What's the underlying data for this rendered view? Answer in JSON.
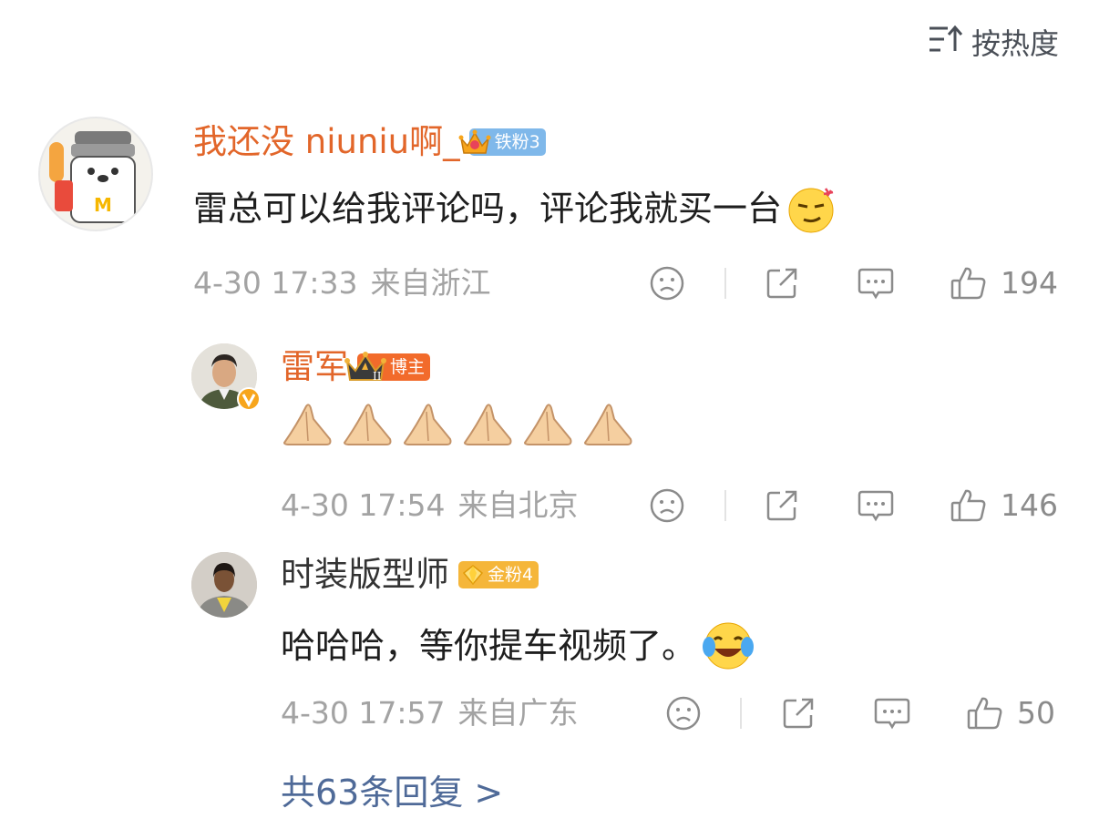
{
  "sort": {
    "label": "按热度",
    "icon": "sort-icon"
  },
  "comments": [
    {
      "username": "我还没 niuniu啊_",
      "badge": {
        "label": "铁粉3",
        "icon": "crown-icon",
        "color": "#7fb8ea"
      },
      "text": "雷总可以给我评论吗，评论我就买一台",
      "emoji": "smirk-emoji",
      "date": "4-30 17:33",
      "location": "来自浙江",
      "likes": "194"
    },
    {
      "username": "雷军",
      "badge": {
        "label": "博主",
        "icon": "crown-icon",
        "color": "#f26b2b"
      },
      "text": "",
      "emoji": "pray-hands-emoji",
      "verified_icon": "verified-v-icon",
      "date": "4-30 17:54",
      "location": "来自北京",
      "likes": "146"
    },
    {
      "username": "时装版型师",
      "badge": {
        "label": "金粉4",
        "icon": "gem-icon",
        "color": "#f5b63a"
      },
      "text": "哈哈哈，等你提车视频了。",
      "emoji": "laugh-tears-emoji",
      "date": "4-30 17:57",
      "location": "来自广东",
      "likes": "50"
    }
  ],
  "more_replies": "共63条回复 >",
  "colors": {
    "username_orange": "#e2662a",
    "link_blue": "#4f6a98",
    "meta_gray": "#a3a3a3"
  }
}
